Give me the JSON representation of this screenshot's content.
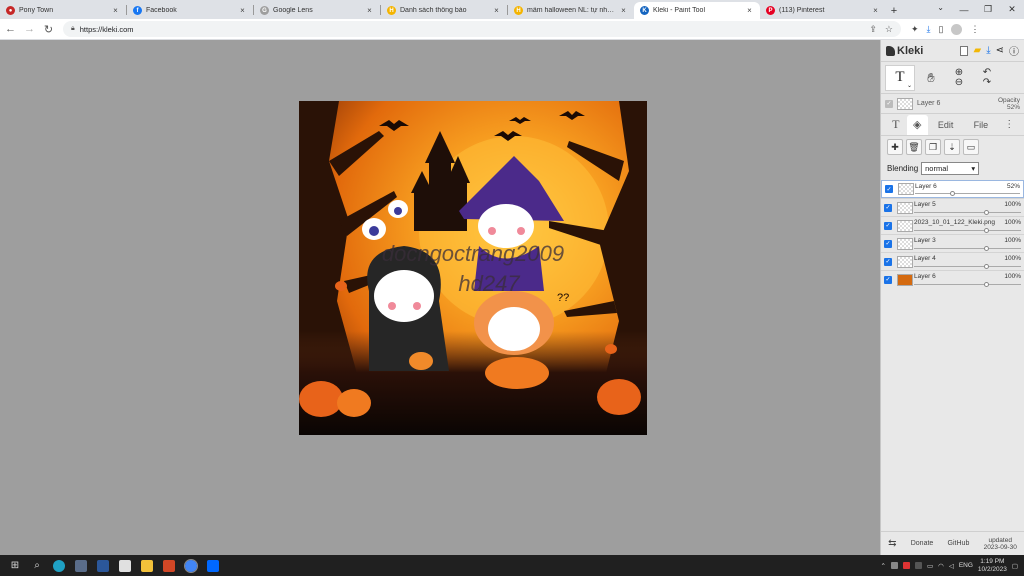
{
  "browser": {
    "tabs": [
      {
        "label": "Pony Town",
        "color": "#c62828",
        "glyph": "●"
      },
      {
        "label": "Facebook",
        "color": "#1877f2",
        "glyph": "f"
      },
      {
        "label": "Google Lens",
        "color": "#9e9e9e",
        "glyph": "G"
      },
      {
        "label": "Danh sách thông báo",
        "color": "#f4b400",
        "glyph": "H"
      },
      {
        "label": "mầm halloween NL: tự nhìn nề...",
        "color": "#f4b400",
        "glyph": "H"
      },
      {
        "label": "Kleki - Paint Tool",
        "color": "#1565c0",
        "glyph": "K"
      },
      {
        "label": "(113) Pinterest",
        "color": "#e60023",
        "glyph": "P"
      }
    ],
    "close_glyph": "×",
    "newtab_glyph": "+",
    "url": "https://kleki.com"
  },
  "kleki": {
    "logo": "Kleki",
    "active_tool": "T",
    "current_layer": {
      "name": "Layer 6",
      "opacity_label": "Opacity",
      "opacity_value": "52%"
    },
    "panel_tabs": {
      "edit": "Edit",
      "file": "File"
    },
    "blending_label": "Blending",
    "blending_value": "normal",
    "layers": [
      {
        "name": "Layer 6",
        "pct": "52%",
        "opacity": 0.52,
        "selected": true
      },
      {
        "name": "Layer 5",
        "pct": "100%",
        "opacity": 1.0
      },
      {
        "name": "2023_10_01_122_Kleki.png",
        "pct": "100%",
        "opacity": 1.0
      },
      {
        "name": "Layer 3",
        "pct": "100%",
        "opacity": 1.0
      },
      {
        "name": "Layer 4",
        "pct": "100%",
        "opacity": 1.0
      },
      {
        "name": "Layer 6",
        "pct": "100%",
        "opacity": 1.0
      }
    ],
    "footer": {
      "donate": "Donate",
      "github": "GitHub",
      "updated_label": "updated",
      "updated_date": "2023-09-30"
    }
  },
  "artwork": {
    "watermark_line1": "docngoctrang2009",
    "watermark_line2": "hd247",
    "question_marks": "??"
  },
  "taskbar": {
    "lang": "ENG",
    "time": "1:19 PM",
    "date": "10/2/2023"
  }
}
